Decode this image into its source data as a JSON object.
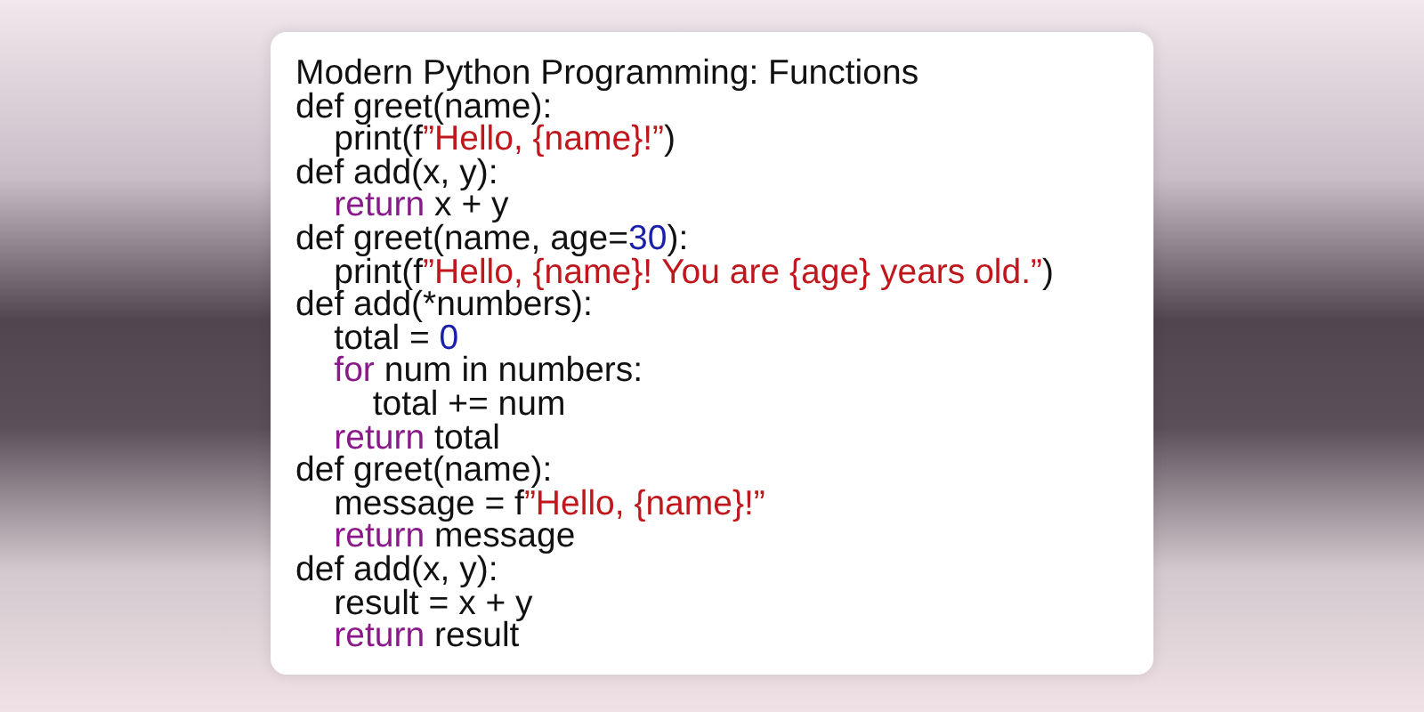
{
  "card": {
    "title": "Modern Python Programming: Functions",
    "lines": [
      [
        {
          "kind": "plain",
          "text": "def greet(name):"
        }
      ],
      [
        {
          "kind": "plain",
          "text": "    print(f"
        },
        {
          "kind": "string",
          "text": "”Hello, {name}!”"
        },
        {
          "kind": "plain",
          "text": ")"
        }
      ],
      [
        {
          "kind": "plain",
          "text": "def add(x, y):"
        }
      ],
      [
        {
          "kind": "keyword",
          "text": "    return"
        },
        {
          "kind": "plain",
          "text": " x + y"
        }
      ],
      [
        {
          "kind": "plain",
          "text": "def greet(name, age="
        },
        {
          "kind": "number",
          "text": "30"
        },
        {
          "kind": "plain",
          "text": "):"
        }
      ],
      [
        {
          "kind": "plain",
          "text": "    print(f"
        },
        {
          "kind": "string",
          "text": "”Hello, {name}! You are {age} years old.”"
        },
        {
          "kind": "plain",
          "text": ")"
        }
      ],
      [
        {
          "kind": "plain",
          "text": "def add(*numbers):"
        }
      ],
      [
        {
          "kind": "plain",
          "text": "    total = "
        },
        {
          "kind": "number",
          "text": "0"
        }
      ],
      [
        {
          "kind": "keyword",
          "text": "    for"
        },
        {
          "kind": "plain",
          "text": " num in numbers:"
        }
      ],
      [
        {
          "kind": "plain",
          "text": "        total += num"
        }
      ],
      [
        {
          "kind": "keyword",
          "text": "    return"
        },
        {
          "kind": "plain",
          "text": " total"
        }
      ],
      [
        {
          "kind": "plain",
          "text": "def greet(name):"
        }
      ],
      [
        {
          "kind": "plain",
          "text": "    message = f"
        },
        {
          "kind": "string",
          "text": "”Hello, {name}!”"
        }
      ],
      [
        {
          "kind": "keyword",
          "text": "    return"
        },
        {
          "kind": "plain",
          "text": " message"
        }
      ],
      [
        {
          "kind": "plain",
          "text": "def add(x, y):"
        }
      ],
      [
        {
          "kind": "plain",
          "text": "    result = x + y"
        }
      ],
      [
        {
          "kind": "keyword",
          "text": "    return"
        },
        {
          "kind": "plain",
          "text": " result"
        }
      ]
    ]
  }
}
